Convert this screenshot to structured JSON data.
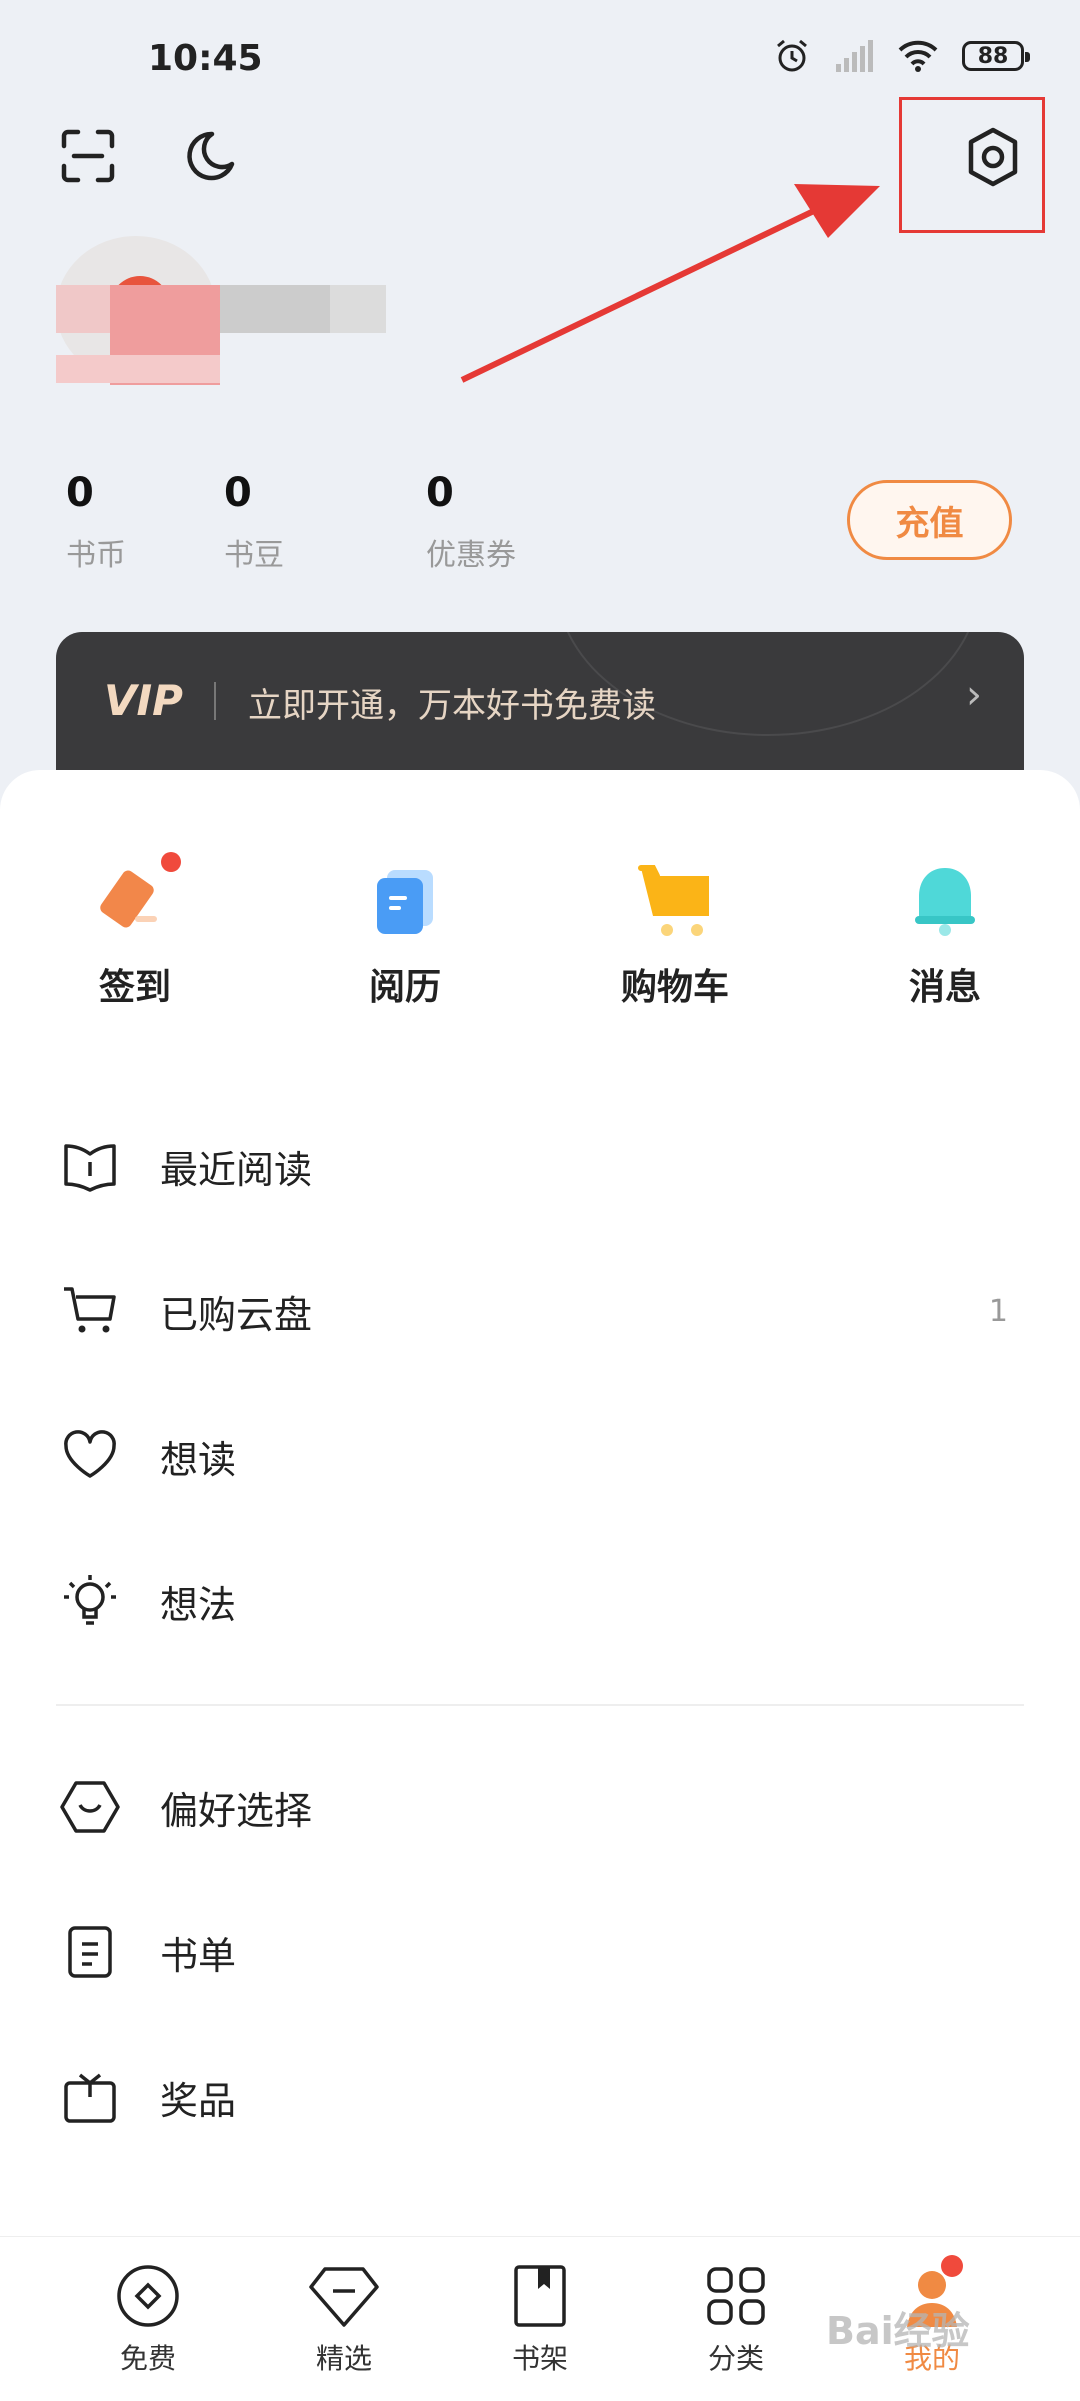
{
  "status_bar": {
    "time": "10:45",
    "battery": "88"
  },
  "stats": [
    {
      "value": "0",
      "label": "书币"
    },
    {
      "value": "0",
      "label": "书豆"
    },
    {
      "value": "0",
      "label": "优惠券"
    }
  ],
  "recharge_label": "充值",
  "vip": {
    "logo": "VIP",
    "text": "立即开通，万本好书免费读",
    "arrow": "›"
  },
  "quick_actions": [
    {
      "label": "签到",
      "icon": "sign-in-icon",
      "badge": true
    },
    {
      "label": "阅历",
      "icon": "reading-history-icon"
    },
    {
      "label": "购物车",
      "icon": "cart-icon"
    },
    {
      "label": "消息",
      "icon": "bell-icon"
    }
  ],
  "menu": [
    {
      "label": "最近阅读",
      "icon": "book-open-icon",
      "count": ""
    },
    {
      "label": "已购云盘",
      "icon": "cart-outline-icon",
      "count": "1"
    },
    {
      "label": "想读",
      "icon": "heart-icon",
      "count": ""
    },
    {
      "label": "想法",
      "icon": "lightbulb-icon",
      "count": ""
    },
    {
      "label": "偏好选择",
      "icon": "hexagon-smile-icon",
      "count": ""
    },
    {
      "label": "书单",
      "icon": "list-doc-icon",
      "count": ""
    },
    {
      "label": "奖品",
      "icon": "gift-icon",
      "count": ""
    }
  ],
  "bottom_nav": [
    {
      "label": "免费",
      "icon": "coin-icon"
    },
    {
      "label": "精选",
      "icon": "diamond-icon"
    },
    {
      "label": "书架",
      "icon": "bookshelf-icon"
    },
    {
      "label": "分类",
      "icon": "grid-icon"
    },
    {
      "label": "我的",
      "icon": "profile-icon",
      "active": true
    }
  ],
  "watermark": "Bai经验",
  "colors": {
    "accent": "#f08a43",
    "vip_bg": "#3a3a3c",
    "annotation": "#e53935",
    "page_bg": "#edf0f5"
  }
}
